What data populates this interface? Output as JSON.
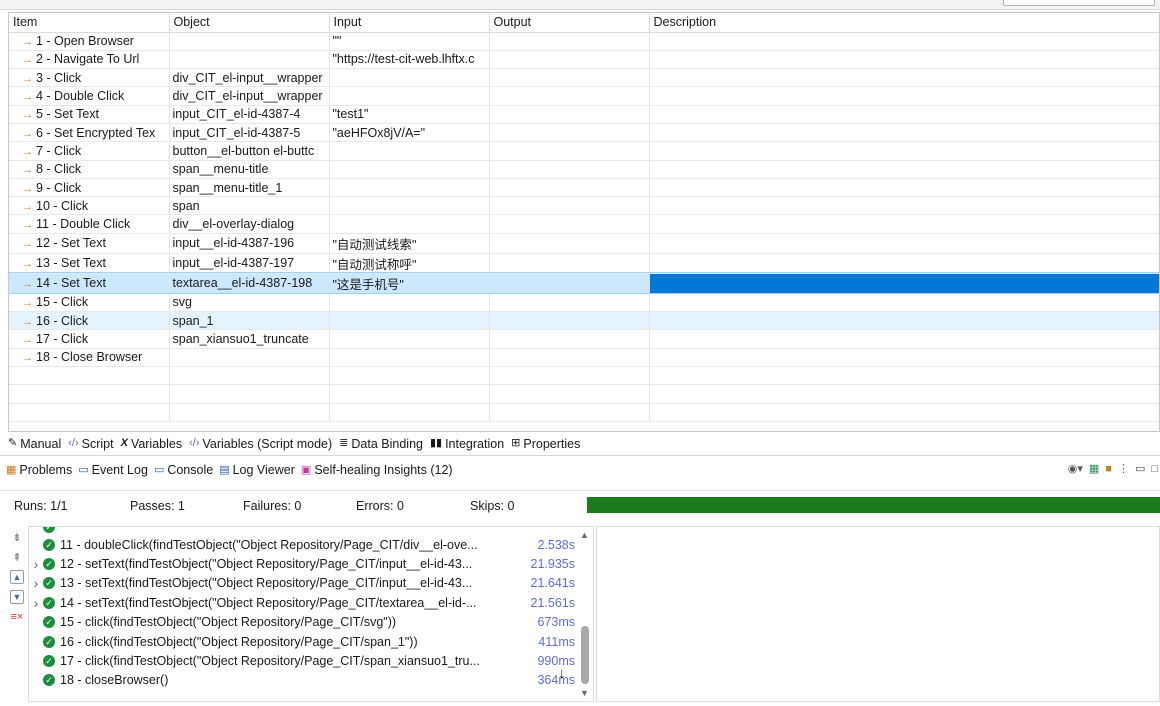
{
  "table": {
    "headers": [
      "Item",
      "Object",
      "Input",
      "Output",
      "Description"
    ],
    "rows": [
      {
        "item": "1 - Open Browser",
        "object": "",
        "input": "\"\"",
        "output": "",
        "description": ""
      },
      {
        "item": "2 - Navigate To Url",
        "object": "",
        "input": "\"https://test-cit-web.lhftx.c",
        "output": "",
        "description": ""
      },
      {
        "item": "3 - Click",
        "object": "div_CIT_el-input__wrapper",
        "input": "",
        "output": "",
        "description": ""
      },
      {
        "item": "4 - Double Click",
        "object": "div_CIT_el-input__wrapper",
        "input": "",
        "output": "",
        "description": ""
      },
      {
        "item": "5 - Set Text",
        "object": "input_CIT_el-id-4387-4",
        "input": "\"test1\"",
        "output": "",
        "description": ""
      },
      {
        "item": "6 - Set Encrypted Tex",
        "object": "input_CIT_el-id-4387-5",
        "input": "\"aeHFOx8jV/A=\"",
        "output": "",
        "description": ""
      },
      {
        "item": "7 - Click",
        "object": "button__el-button el-buttc",
        "input": "",
        "output": "",
        "description": ""
      },
      {
        "item": "8 - Click",
        "object": "span__menu-title",
        "input": "",
        "output": "",
        "description": ""
      },
      {
        "item": "9 - Click",
        "object": "span__menu-title_1",
        "input": "",
        "output": "",
        "description": ""
      },
      {
        "item": "10 - Click",
        "object": "span",
        "input": "",
        "output": "",
        "description": ""
      },
      {
        "item": "11 - Double Click",
        "object": "div__el-overlay-dialog",
        "input": "",
        "output": "",
        "description": ""
      },
      {
        "item": "12 - Set Text",
        "object": "input__el-id-4387-196",
        "input": "\"自动测试线索\"",
        "output": "",
        "description": ""
      },
      {
        "item": "13 - Set Text",
        "object": "input__el-id-4387-197",
        "input": "\"自动测试称呼\"",
        "output": "",
        "description": ""
      },
      {
        "item": "14 - Set Text",
        "object": "textarea__el-id-4387-198",
        "input": "\"这是手机号\"",
        "output": "",
        "description": ""
      },
      {
        "item": "15 - Click",
        "object": "svg",
        "input": "",
        "output": "",
        "description": ""
      },
      {
        "item": "16 - Click",
        "object": "span_1",
        "input": "",
        "output": "",
        "description": ""
      },
      {
        "item": "17 - Click",
        "object": "span_xiansuo1_truncate",
        "input": "",
        "output": "",
        "description": ""
      },
      {
        "item": "18 - Close Browser",
        "object": "",
        "input": "",
        "output": "",
        "description": ""
      }
    ],
    "selected_row": 14,
    "hover_row": 16
  },
  "editor_tabs": [
    {
      "label": "Manual",
      "icon": "manual-icon"
    },
    {
      "label": "Script",
      "icon": "code-icon"
    },
    {
      "label": "Variables",
      "icon": "variables-icon"
    },
    {
      "label": "Variables (Script mode)",
      "icon": "code-icon"
    },
    {
      "label": "Data Binding",
      "icon": "database-icon"
    },
    {
      "label": "Integration",
      "icon": "integration-icon"
    },
    {
      "label": "Properties",
      "icon": "properties-icon"
    }
  ],
  "console_tabs": [
    {
      "label": "Problems",
      "icon": "problems-icon"
    },
    {
      "label": "Event Log",
      "icon": "event-log-icon"
    },
    {
      "label": "Console",
      "icon": "console-icon"
    },
    {
      "label": "Log Viewer",
      "icon": "log-viewer-icon"
    },
    {
      "label": "Self-healing Insights (12)",
      "icon": "self-healing-icon"
    }
  ],
  "summary": {
    "runs": "Runs: 1/1",
    "passes": "Passes: 1",
    "failures": "Failures: 0",
    "errors": "Errors: 0",
    "skips": "Skips: 0",
    "progress": 1.0,
    "progress_color": "#1b7b1b"
  },
  "log": [
    {
      "text": "11 - doubleClick(findTestObject(\"Object Repository/Page_CIT/div__el-ove...",
      "duration": "2.538s",
      "expandable": false
    },
    {
      "text": "12 - setText(findTestObject(\"Object Repository/Page_CIT/input__el-id-43...",
      "duration": "21.935s",
      "expandable": true
    },
    {
      "text": "13 - setText(findTestObject(\"Object Repository/Page_CIT/input__el-id-43...",
      "duration": "21.641s",
      "expandable": true
    },
    {
      "text": "14 - setText(findTestObject(\"Object Repository/Page_CIT/textarea__el-id-...",
      "duration": "21.561s",
      "expandable": true
    },
    {
      "text": "15 - click(findTestObject(\"Object Repository/Page_CIT/svg\"))",
      "duration": "673ms",
      "expandable": false
    },
    {
      "text": "16 - click(findTestObject(\"Object Repository/Page_CIT/span_1\"))",
      "duration": "411ms",
      "expandable": false
    },
    {
      "text": "17 - click(findTestObject(\"Object Repository/Page_CIT/span_xiansuo1_tru...",
      "duration": "990ms",
      "expandable": false
    },
    {
      "text": "18 - closeBrowser()",
      "duration": "364ms",
      "expandable": false
    }
  ],
  "colors": {
    "selection": "#cce8ff",
    "selection_strong": "#0078d7",
    "pass": "#1e8e3e",
    "duration": "#5a6fd6",
    "step_icon": "#e8742a"
  }
}
